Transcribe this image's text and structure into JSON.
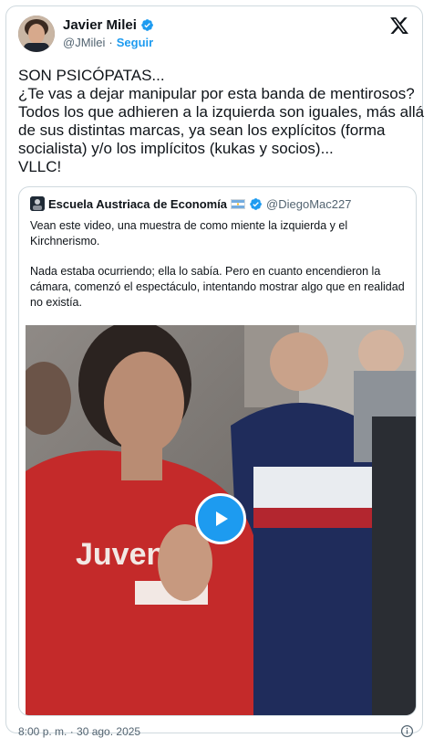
{
  "author": {
    "name": "Javier Milei",
    "handle": "@JMilei",
    "separator": "·",
    "follow_label": "Seguir"
  },
  "tweet": {
    "lines": [
      "SON PSICÓPATAS...",
      "¿Te vas a dejar manipular por esta banda de mentirosos?",
      "Todos los que adhieren a la izquierda son iguales, más allá",
      "de sus distintas marcas, ya sean los explícitos (forma",
      "socialista) y/o los implícitos (kukas y socios)...",
      "VLLC!"
    ]
  },
  "quote": {
    "name": "Escuela Austriaca de Economía",
    "handle": "@DiegoMac227",
    "paragraph1": "Vean este video, una muestra de como miente la izquierda y el Kirchnerismo.",
    "paragraph2": "Nada estaba ocurriendo; ella lo sabía. Pero en cuanto encendieron la cámara, comenzó el espectáculo, intentando mostrar algo que en realidad no existía.",
    "video_shirt_text": "Juvent"
  },
  "footer": {
    "timestamp": "8:00 p. m. · 30 ago. 2025"
  },
  "colors": {
    "accent": "#1d9bf0",
    "text": "#0f1419",
    "muted": "#536471",
    "border": "#cfd9de"
  },
  "icons": [
    "verified-badge-icon",
    "x-logo-icon",
    "argentina-flag-icon",
    "play-icon",
    "info-icon"
  ]
}
